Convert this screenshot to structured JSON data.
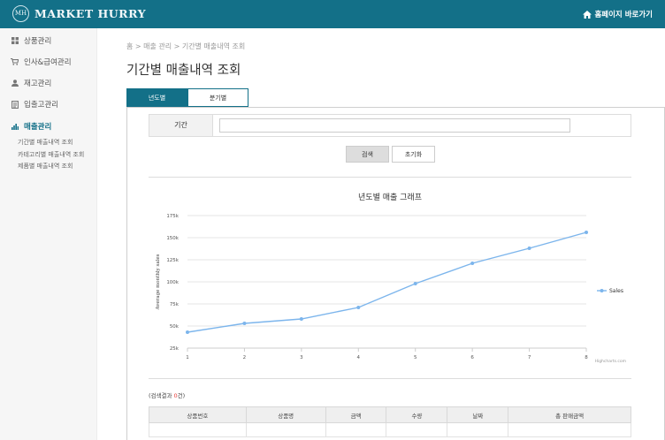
{
  "header": {
    "logo_mark": "MH",
    "logo_text": "MARKET HURRY",
    "home_link": "홈페이지 바로가기",
    "color": "#137088"
  },
  "sidebar": {
    "items": [
      {
        "label": "상품관리",
        "icon": "grid-icon"
      },
      {
        "label": "인사&급여관리",
        "icon": "cart-icon"
      },
      {
        "label": "재고관리",
        "icon": "user-icon"
      },
      {
        "label": "입출고관리",
        "icon": "document-icon"
      },
      {
        "label": "매출관리",
        "icon": "bar-chart-icon",
        "active": true
      }
    ],
    "sub_items": [
      "기간별 매출내역 조회",
      "카테고리별 매출내역 조회",
      "제품별 매출내역 조회"
    ]
  },
  "main": {
    "breadcrumb": "홈 > 매출 관리 > 기간별 매출내역 조회",
    "title": "기간별 매출내역 조회",
    "tabs": [
      {
        "label": "년도별",
        "active": true
      },
      {
        "label": "분기별",
        "active": false
      }
    ],
    "period_label": "기간",
    "period_value": "",
    "search_button": "검색",
    "reset_button": "초기화",
    "result_prefix": "(검색결과 ",
    "result_count": "0",
    "result_suffix": "건)",
    "table_headers": [
      "상품번호",
      "상품명",
      "금액",
      "수량",
      "날짜",
      "총 판매금액"
    ]
  },
  "chart_data": {
    "type": "line",
    "title": "년도별 매출 그래프",
    "ylabel": "Average monthly sales",
    "xlabel": "",
    "x": [
      1,
      2,
      3,
      4,
      5,
      6,
      7,
      8
    ],
    "series": [
      {
        "name": "Sales",
        "values": [
          43,
          53,
          58,
          71,
          98,
          121,
          138,
          156
        ],
        "color": "#7cb5ec"
      }
    ],
    "y_ticks": [
      "25k",
      "50k",
      "75k",
      "100k",
      "125k",
      "150k",
      "175k"
    ],
    "y_tick_values": [
      25,
      50,
      75,
      100,
      125,
      150,
      175
    ],
    "ylim": [
      25,
      175
    ],
    "legend": "right",
    "credits": "Highcharts.com"
  }
}
